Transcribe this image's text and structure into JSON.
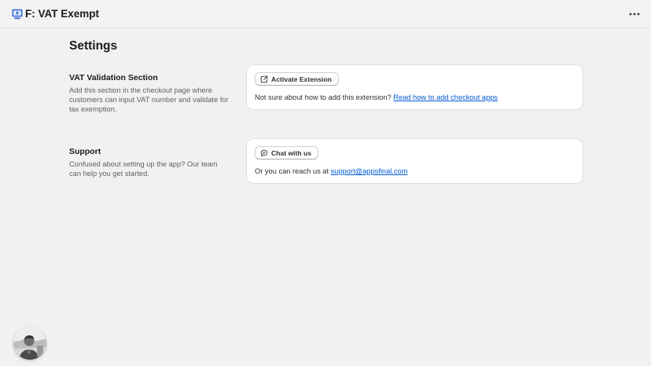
{
  "header": {
    "app_title": "F: VAT Exempt",
    "app_icon": "monitor-app-icon",
    "more_icon": "more-horizontal-icon"
  },
  "page": {
    "title": "Settings"
  },
  "sections": {
    "vat": {
      "heading": "VAT Validation Section",
      "description": "Add this section in the checkout page where customers can input VAT number and validate for tax exemption.",
      "button_label": "Activate Extension",
      "button_icon": "external-link-icon",
      "text_prefix": "Not sure about how to add this extension?",
      "link_label": "Read how to add checkout apps"
    },
    "support": {
      "heading": "Support",
      "description": "Confused about setting up the app? Our team can help you get started.",
      "button_label": "Chat with us",
      "button_icon": "chat-bubble-icon",
      "text_prefix": "Or you can reach us at",
      "link_label": "support@appsfinal.com"
    }
  },
  "colors": {
    "background": "#f1f1f1",
    "card": "#ffffff",
    "link": "#005bd3",
    "app_icon": "#3b6fd8"
  }
}
